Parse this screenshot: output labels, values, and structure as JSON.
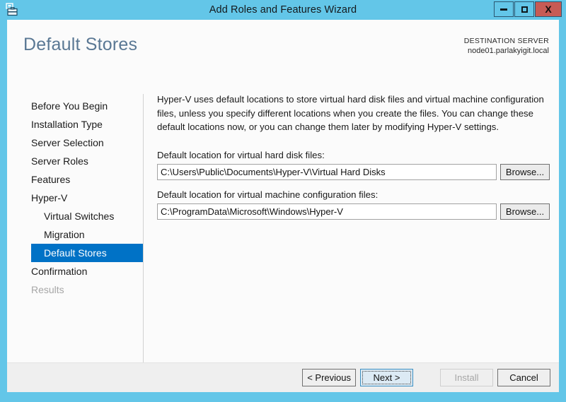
{
  "window": {
    "title": "Add Roles and Features Wizard",
    "icon": "server-manager-icon",
    "frame_color": "#63c6e8",
    "controls": {
      "minimize_label": "minimize-icon",
      "maximize_label": "maximize-icon",
      "close_label": "X"
    }
  },
  "header": {
    "page_title": "Default Stores",
    "destination_label": "DESTINATION SERVER",
    "destination_server": "node01.parlakyigit.local",
    "title_color": "#5a7894"
  },
  "nav": {
    "selected_color": "#0072c6",
    "items": [
      {
        "label": "Before You Begin",
        "state": "normal",
        "level": 0
      },
      {
        "label": "Installation Type",
        "state": "normal",
        "level": 0
      },
      {
        "label": "Server Selection",
        "state": "normal",
        "level": 0
      },
      {
        "label": "Server Roles",
        "state": "normal",
        "level": 0
      },
      {
        "label": "Features",
        "state": "normal",
        "level": 0
      },
      {
        "label": "Hyper-V",
        "state": "normal",
        "level": 0
      },
      {
        "label": "Virtual Switches",
        "state": "normal",
        "level": 1
      },
      {
        "label": "Migration",
        "state": "normal",
        "level": 1
      },
      {
        "label": "Default Stores",
        "state": "selected",
        "level": 1
      },
      {
        "label": "Confirmation",
        "state": "normal",
        "level": 0
      },
      {
        "label": "Results",
        "state": "disabled",
        "level": 0
      }
    ]
  },
  "content": {
    "description": "Hyper-V uses default locations to store virtual hard disk files and virtual machine configuration files, unless you specify different locations when you create the files. You can change these default locations now, or you can change them later by modifying Hyper-V settings.",
    "fields": [
      {
        "label": "Default location for virtual hard disk files:",
        "value": "C:\\Users\\Public\\Documents\\Hyper-V\\Virtual Hard Disks",
        "browse_label": "Browse..."
      },
      {
        "label": "Default location for virtual machine configuration files:",
        "value": "C:\\ProgramData\\Microsoft\\Windows\\Hyper-V",
        "browse_label": "Browse..."
      }
    ]
  },
  "footer": {
    "previous_label": "< Previous",
    "next_label": "Next >",
    "install_label": "Install",
    "cancel_label": "Cancel",
    "next_focused": true,
    "install_enabled": false
  }
}
